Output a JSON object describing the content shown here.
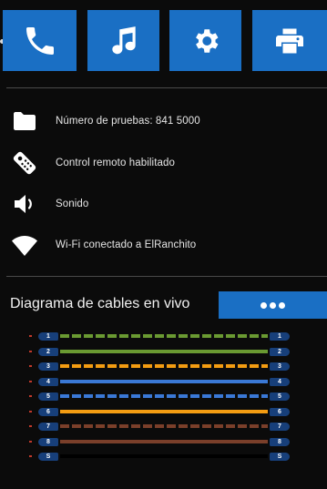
{
  "toolbar": {
    "buttons": [
      {
        "name": "phone",
        "icon": "phone-icon"
      },
      {
        "name": "music",
        "icon": "music-note-icon"
      },
      {
        "name": "settings",
        "icon": "gear-icon"
      },
      {
        "name": "print",
        "icon": "printer-icon"
      }
    ],
    "accent_color": "#1a6fc4"
  },
  "info": {
    "tests": {
      "icon": "folder-icon",
      "label": "Número de pruebas: 841 5000"
    },
    "remote": {
      "icon": "remote-control-icon",
      "label": "Control remoto habilitado"
    },
    "sound": {
      "icon": "speaker-icon",
      "label": "Sonido"
    },
    "wifi": {
      "icon": "wifi-icon",
      "label": "Wi-Fi conectado a ElRanchito"
    }
  },
  "diagram": {
    "title": "Diagrama de cables en vivo",
    "more_button": "more-options-icon",
    "wires": [
      {
        "left": "1",
        "right": "1",
        "color": "#6a9a32",
        "style": "dashed"
      },
      {
        "left": "2",
        "right": "2",
        "color": "#6a9a32",
        "style": "solid"
      },
      {
        "left": "3",
        "right": "3",
        "color": "#f39c12",
        "style": "dashed"
      },
      {
        "left": "4",
        "right": "4",
        "color": "#3a78d6",
        "style": "solid"
      },
      {
        "left": "5",
        "right": "5",
        "color": "#3a78d6",
        "style": "dashed"
      },
      {
        "left": "6",
        "right": "6",
        "color": "#f39c12",
        "style": "solid"
      },
      {
        "left": "7",
        "right": "7",
        "color": "#7a3f2a",
        "style": "dashed"
      },
      {
        "left": "8",
        "right": "8",
        "color": "#7a3f2a",
        "style": "solid"
      },
      {
        "left": "S",
        "right": "S",
        "color": "#000000",
        "style": "solid"
      }
    ]
  }
}
